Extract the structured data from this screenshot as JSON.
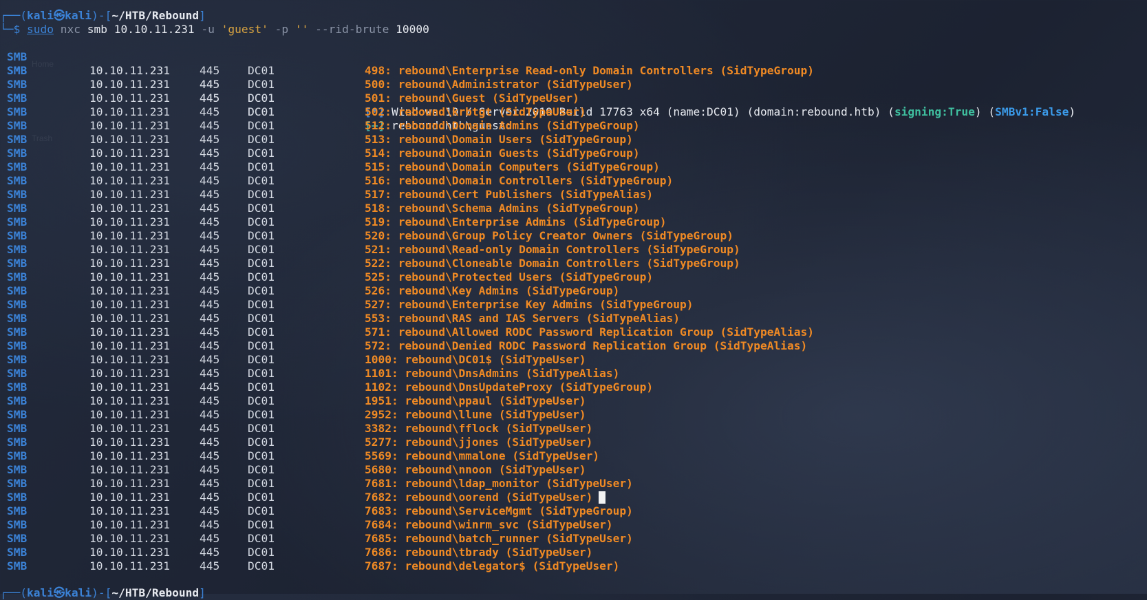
{
  "bg": {
    "home": "Home",
    "trash": "Trash"
  },
  "prompt": {
    "user": "kali",
    "host": "kali",
    "at_symbol": "㉿",
    "path": "~/HTB/Rebound",
    "sudo": "sudo",
    "tool": "nxc",
    "cmd_rest": " smb 10.10.11.231 ",
    "flag_u": "-u",
    "user_arg": "'guest'",
    "flag_p": "-p",
    "pass_arg": "''",
    "flag_rid": "--rid-brute",
    "rid_max": "10000"
  },
  "common": {
    "proto": "SMB",
    "ip": "10.10.11.231",
    "port": "445",
    "host": "DC01"
  },
  "info_line": {
    "tag": "[*]",
    "text": "Windows 10 / Server 2019 Build 17763 x64 (name:DC01) (domain:rebound.htb) (",
    "signing": "signing:True",
    "mid": ") (",
    "smbv1": "SMBv1:False",
    "end": ")"
  },
  "auth_line": {
    "tag": "[+]",
    "text": "rebound.htb\\guest:"
  },
  "rids": [
    "498: rebound\\Enterprise Read-only Domain Controllers (SidTypeGroup)",
    "500: rebound\\Administrator (SidTypeUser)",
    "501: rebound\\Guest (SidTypeUser)",
    "502: rebound\\krbtgt (SidTypeUser)",
    "512: rebound\\Domain Admins (SidTypeGroup)",
    "513: rebound\\Domain Users (SidTypeGroup)",
    "514: rebound\\Domain Guests (SidTypeGroup)",
    "515: rebound\\Domain Computers (SidTypeGroup)",
    "516: rebound\\Domain Controllers (SidTypeGroup)",
    "517: rebound\\Cert Publishers (SidTypeAlias)",
    "518: rebound\\Schema Admins (SidTypeGroup)",
    "519: rebound\\Enterprise Admins (SidTypeGroup)",
    "520: rebound\\Group Policy Creator Owners (SidTypeGroup)",
    "521: rebound\\Read-only Domain Controllers (SidTypeGroup)",
    "522: rebound\\Cloneable Domain Controllers (SidTypeGroup)",
    "525: rebound\\Protected Users (SidTypeGroup)",
    "526: rebound\\Key Admins (SidTypeGroup)",
    "527: rebound\\Enterprise Key Admins (SidTypeGroup)",
    "553: rebound\\RAS and IAS Servers (SidTypeAlias)",
    "571: rebound\\Allowed RODC Password Replication Group (SidTypeAlias)",
    "572: rebound\\Denied RODC Password Replication Group (SidTypeAlias)",
    "1000: rebound\\DC01$ (SidTypeUser)",
    "1101: rebound\\DnsAdmins (SidTypeAlias)",
    "1102: rebound\\DnsUpdateProxy (SidTypeGroup)",
    "1951: rebound\\ppaul (SidTypeUser)",
    "2952: rebound\\llune (SidTypeUser)",
    "3382: rebound\\fflock (SidTypeUser)",
    "5277: rebound\\jjones (SidTypeUser)",
    "5569: rebound\\mmalone (SidTypeUser)",
    "5680: rebound\\nnoon (SidTypeUser)",
    "7681: rebound\\ldap_monitor (SidTypeUser)",
    "7682: rebound\\oorend (SidTypeUser)",
    "7683: rebound\\ServiceMgmt (SidTypeGroup)",
    "7684: rebound\\winrm_svc (SidTypeUser)",
    "7685: rebound\\batch_runner (SidTypeUser)",
    "7686: rebound\\tbrady (SidTypeUser)",
    "7687: rebound\\delegator$ (SidTypeUser)"
  ],
  "cursor_after_index": 31
}
